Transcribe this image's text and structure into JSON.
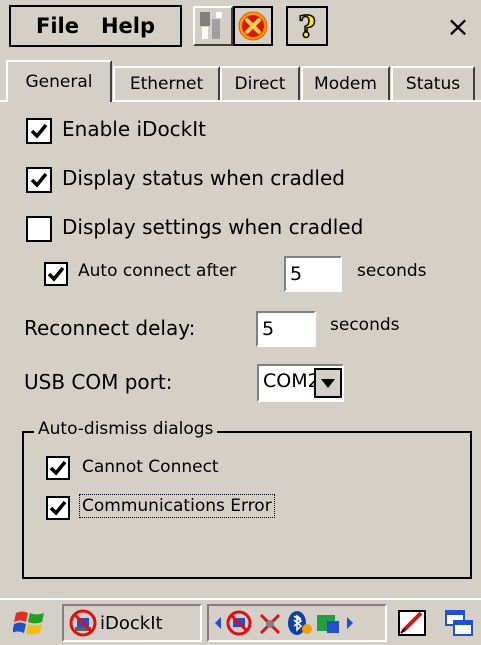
{
  "menubar": {
    "file_label": "File",
    "help_label": "Help",
    "close_glyph": "×",
    "help_icon_glyph": "?"
  },
  "tabs": [
    {
      "label": "General",
      "active": true
    },
    {
      "label": "Ethernet",
      "active": false
    },
    {
      "label": "Direct",
      "active": false
    },
    {
      "label": "Modem",
      "active": false
    },
    {
      "label": "Status",
      "active": false
    }
  ],
  "general": {
    "enable_idockit": {
      "label": "Enable iDockIt",
      "checked": true
    },
    "display_status": {
      "label": "Display status when cradled",
      "checked": true
    },
    "display_settings": {
      "label": "Display settings when cradled",
      "checked": false
    },
    "auto_connect": {
      "label": "Auto connect after",
      "checked": true,
      "value": "5",
      "unit": "seconds"
    },
    "reconnect_delay": {
      "label": "Reconnect delay:",
      "value": "5",
      "unit": "seconds"
    },
    "usb_com_port": {
      "label": "USB COM port:",
      "value": "COM2:"
    }
  },
  "auto_dismiss": {
    "legend": "Auto-dismiss dialogs",
    "cannot_connect": {
      "label": "Cannot Connect",
      "checked": true
    },
    "communications_error": {
      "label": "Communications Error",
      "checked": true
    }
  },
  "taskbar": {
    "app_label": "iDockIt"
  }
}
